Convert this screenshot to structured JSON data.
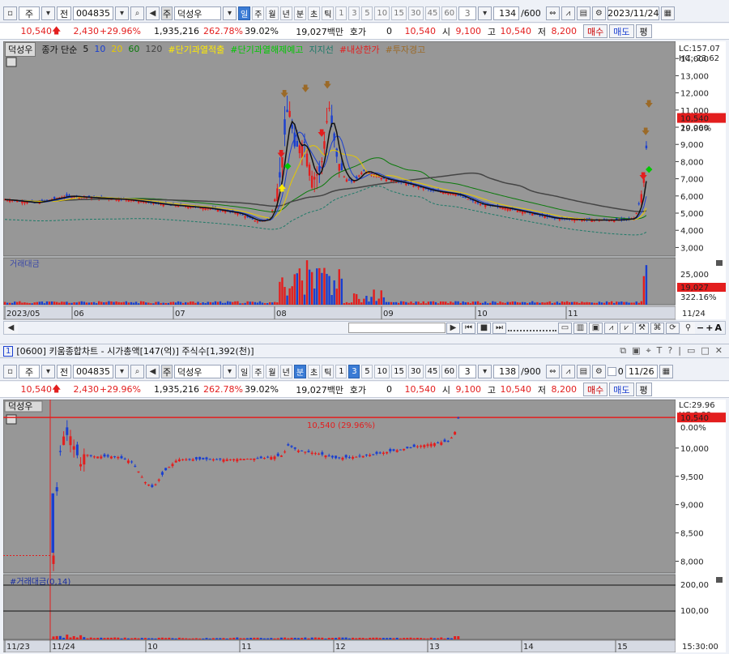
{
  "upper": {
    "toolbar": {
      "stock_code": "004835",
      "stock_name": "덕성우",
      "prefix_label": "주",
      "prev_label": "전",
      "name_tag": "주",
      "periods": [
        "일",
        "주",
        "월",
        "년",
        "분",
        "초",
        "틱"
      ],
      "selected_period": "일",
      "minutes": [
        "1",
        "3",
        "5",
        "10",
        "15",
        "30",
        "45",
        "60"
      ],
      "interval_value": "3",
      "count": "134",
      "count_total": "/600",
      "date": "2023/11/24"
    },
    "quote": {
      "price": "10,540",
      "change": "2,430",
      "change_pct": "+29.96%",
      "volume": "1,935,216",
      "volume_ratio": "262.78%",
      "turnover": "39.02%",
      "amount": "19,027백만",
      "hoga_label": "호가",
      "hoga_value": "0",
      "hoga_price": "10,540",
      "open_label": "시",
      "open": "9,100",
      "high_label": "고",
      "high": "10,540",
      "low_label": "저",
      "low": "8,200",
      "buy": "매수",
      "sell": "매도",
      "eval": "평"
    },
    "legend": {
      "name": "덕성우",
      "ma_label": "종가 단순",
      "ma5": "5",
      "ma10": "10",
      "ma20": "20",
      "ma60": "60",
      "ma120": "120",
      "ind1": "#단기과열적출",
      "ind2": "#단기과열해제예고",
      "ind3": "지지선",
      "ind4": "#내상한가",
      "ind5": "#투자경고"
    },
    "lc": "LC:157.07",
    "hc": "HC:-23.62",
    "price_tag": "10,540",
    "pct_tag": "29.96%",
    "y_ticks": [
      "14,000",
      "13,000",
      "12,000",
      "11,000",
      "10,000",
      "9,000",
      "8,000",
      "7,000",
      "6,000",
      "5,000",
      "4,000",
      "3,000"
    ],
    "vol_label": "거래대금",
    "vol_tick": "25,000",
    "vol_tag": "19,027",
    "vol_pct": "322.16%",
    "x_ticks": [
      "2023/05",
      "06",
      "07",
      "08",
      "09",
      "10",
      "11"
    ],
    "x_end": "11/24"
  },
  "lower": {
    "title": "[0600] 키움종합차트 - 시가총액[147(억)] 주식수[1,392(천)]",
    "toolbar": {
      "stock_code": "004835",
      "stock_name": "덕성우",
      "prefix_label": "주",
      "prev_label": "전",
      "name_tag": "주",
      "periods": [
        "일",
        "주",
        "월",
        "년",
        "분",
        "초",
        "틱"
      ],
      "selected_period": "분",
      "minutes": [
        "1",
        "3",
        "5",
        "10",
        "15",
        "30",
        "45",
        "60"
      ],
      "selected_minute": "3",
      "interval_value": "3",
      "count": "138",
      "count_total": "/900",
      "checkbox_label": "0",
      "date": "11/26"
    },
    "quote": {
      "price": "10,540",
      "change": "2,430",
      "change_pct": "+29.96%",
      "volume": "1,935,216",
      "volume_ratio": "262.78%",
      "turnover": "39.02%",
      "amount": "19,027백만",
      "hoga_label": "호가",
      "hoga_value": "0",
      "hoga_price": "10,540",
      "open_label": "시",
      "open": "9,100",
      "high_label": "고",
      "high": "10,540",
      "low_label": "저",
      "low": "8,200",
      "buy": "매수",
      "sell": "매도",
      "eval": "평"
    },
    "legend_name": "덕성우",
    "lc": "LC:29.96",
    "hc": "HC:0.00",
    "price_tag": "10,540",
    "pct_tag": "0.00%",
    "limit_label": "10,540 (29.96%)",
    "y_ticks": [
      "10,000",
      "9,500",
      "9,000",
      "8,500",
      "8,000"
    ],
    "vol_label": "#거래대금(0,14)",
    "vol_ticks": [
      "200,00",
      "100,00"
    ],
    "x_ticks": [
      "11/23",
      "11/24",
      "10",
      "11",
      "12",
      "13",
      "14",
      "15"
    ],
    "x_end": "15:30:00"
  },
  "chart_data": [
    {
      "type": "candlestick",
      "title": "",
      "x_ticks": [
        "2023/05",
        "06",
        "07",
        "08",
        "09",
        "10",
        "11",
        "11/24"
      ],
      "ylim": [
        2500,
        15000
      ],
      "close_series_approx": [
        {
          "x": "2023/05",
          "y": 5800
        },
        {
          "x": "06",
          "y": 6000
        },
        {
          "x": "07",
          "y": 5400
        },
        {
          "x": "08 start",
          "y": 4400
        },
        {
          "x": "08 spike",
          "y": 11500
        },
        {
          "x": "09",
          "y": 6800
        },
        {
          "x": "10",
          "y": 6000
        },
        {
          "x": "11",
          "y": 4700
        },
        {
          "x": "11/24",
          "y": 10540
        }
      ]
    },
    {
      "type": "candlestick",
      "title": "",
      "x_ticks": [
        "11/23",
        "11/24",
        "10",
        "11",
        "12",
        "13",
        "14",
        "15"
      ],
      "ylim": [
        7850,
        10800
      ],
      "close_series_approx": [
        {
          "x": "11/24 09:00",
          "y": 8100
        },
        {
          "x": "11/24 09:10",
          "y": 10250
        },
        {
          "x": "11/24 10",
          "y": 9850
        },
        {
          "x": "11/24 10:30",
          "y": 9300
        },
        {
          "x": "11/24 11",
          "y": 9750
        },
        {
          "x": "11/24 12",
          "y": 9850
        },
        {
          "x": "11/24 13",
          "y": 10150
        },
        {
          "x": "11/24 13:30",
          "y": 10540
        }
      ]
    }
  ]
}
